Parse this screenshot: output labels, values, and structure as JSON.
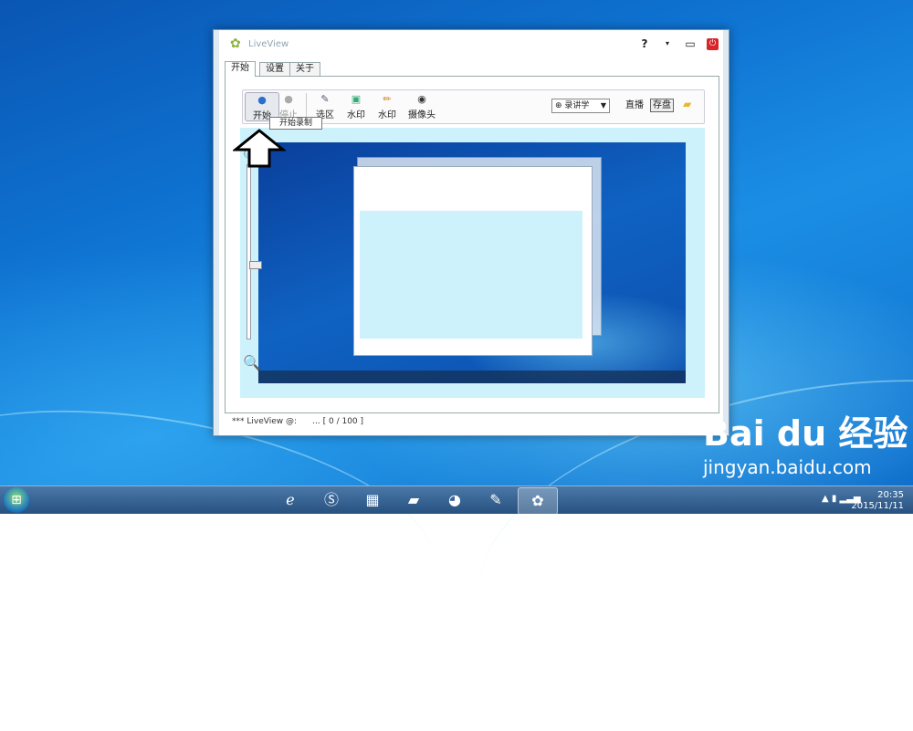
{
  "window": {
    "title": "LiveView",
    "help": "?",
    "menu": "▾",
    "restore": "▭",
    "close": "⏻"
  },
  "tabs": [
    "开始",
    "设置",
    "关于"
  ],
  "toolbar": {
    "start_label": "开始",
    "stop_label": "停止",
    "region_label": "选区",
    "watermark_image_label": "水印",
    "watermark_text_label": "水印",
    "camera_label": "摄像头",
    "mode_select": "录讲学",
    "live_label": "直播",
    "save_label": "存盘"
  },
  "tooltip": "开始录制",
  "status": {
    "app_text": "*** LiveView @:",
    "progress_text": "... [ 0 / 100 ]"
  },
  "zoom": {
    "level": 0.6
  },
  "watermark": {
    "logo": "Bai du 经验",
    "url": "jingyan.baidu.com"
  },
  "clock": {
    "time": "20:35",
    "date": "2015/11/11"
  },
  "colors": {
    "accent": "#1f6fd0",
    "close": "#d8262b",
    "preview_bg": "#cdf2fb"
  }
}
